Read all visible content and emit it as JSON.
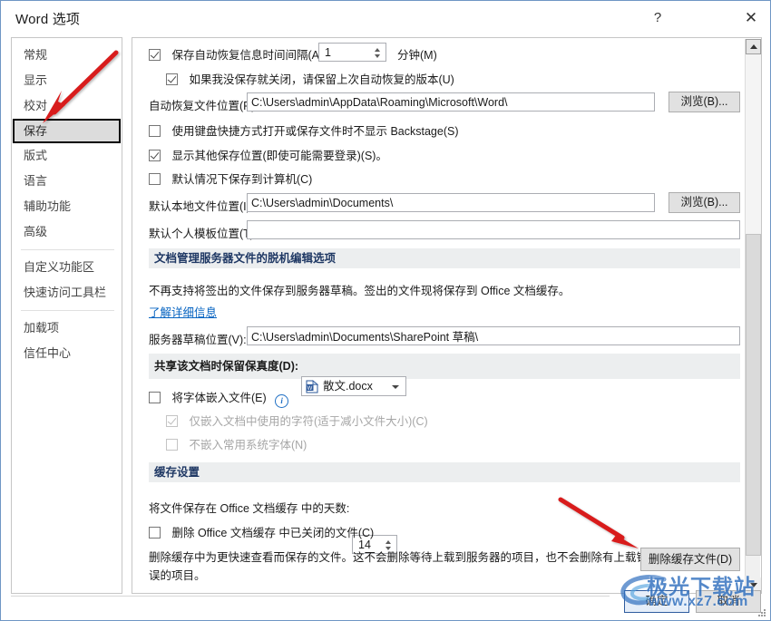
{
  "window": {
    "title": "Word 选项",
    "help_label": "?",
    "close_label": "✕"
  },
  "sidebar": {
    "items": [
      {
        "label": "常规",
        "selected": false
      },
      {
        "label": "显示",
        "selected": false
      },
      {
        "label": "校对",
        "selected": false
      },
      {
        "label": "保存",
        "selected": true
      },
      {
        "label": "版式",
        "selected": false
      },
      {
        "label": "语言",
        "selected": false
      },
      {
        "label": "辅助功能",
        "selected": false
      },
      {
        "label": "高级",
        "selected": false
      },
      {
        "label": "自定义功能区",
        "selected": false
      },
      {
        "label": "快速访问工具栏",
        "selected": false
      },
      {
        "label": "加载项",
        "selected": false
      },
      {
        "label": "信任中心",
        "selected": false
      }
    ]
  },
  "main": {
    "autorecover": {
      "interval_checkbox_label": "保存自动恢复信息时间间隔(A)",
      "interval_checked": true,
      "interval_value": "1",
      "minutes_label": "分钟(M)",
      "keep_last_checkbox_label": "如果我没保存就关闭，请保留上次自动恢复的版本(U)",
      "keep_last_checked": true,
      "location_label": "自动恢复文件位置(R):",
      "location_value": "C:\\Users\\admin\\AppData\\Roaming\\Microsoft\\Word\\",
      "browse_label": "浏览(B)..."
    },
    "backstage_checkbox_label": "使用键盘快捷方式打开或保存文件时不显示 Backstage(S)",
    "backstage_checked": false,
    "show_other_locations_label": "显示其他保存位置(即使可能需要登录)(S)。",
    "show_other_locations_checked": true,
    "save_to_computer_label": "默认情况下保存到计算机(C)",
    "save_to_computer_checked": false,
    "local_file_location_label": "默认本地文件位置(I):",
    "local_file_location_value": "C:\\Users\\admin\\Documents\\",
    "local_browse_label": "浏览(B)...",
    "personal_template_label": "默认个人模板位置(T):",
    "personal_template_value": "",
    "offline_section": {
      "header": "文档管理服务器文件的脱机编辑选项",
      "description": "不再支持将签出的文件保存到服务器草稿。签出的文件现将保存到 Office 文档缓存。",
      "link_label": "了解详细信息",
      "draft_location_label": "服务器草稿位置(V):",
      "draft_location_value": "C:\\Users\\admin\\Documents\\SharePoint 草稿\\"
    },
    "fidelity_section": {
      "header": "共享该文档时保留保真度(D):",
      "doc_name": "散文.docx",
      "doc_icon": "word-document-icon",
      "embed_fonts_label": "将字体嵌入文件(E)",
      "embed_fonts_checked": false,
      "info_icon": "info-icon",
      "embed_used_chars_label": "仅嵌入文档中使用的字符(适于减小文件大小)(C)",
      "embed_used_chars_checked": true,
      "embed_used_chars_disabled": true,
      "no_embed_system_label": "不嵌入常用系统字体(N)",
      "no_embed_system_checked": false,
      "no_embed_system_disabled": true
    },
    "cache_section": {
      "header": "缓存设置",
      "days_label": "将文件保存在 Office 文档缓存 中的天数:",
      "days_value": "14",
      "delete_closed_label": "删除 Office 文档缓存 中已关闭的文件(C)",
      "delete_closed_checked": false,
      "description_line1": "删除缓存中为更快速查看而保存的文件。这不会删除等待上载到服务器的项目，也不会删除有上载错",
      "description_line2": "误的项目。",
      "delete_cache_button_label": "删除缓存文件(D)"
    }
  },
  "footer": {
    "ok_label": "确定",
    "cancel_label": "取消"
  },
  "annotations": {
    "arrow_color": "#d81f1f",
    "arrow_1_target": "保存",
    "arrow_2_target": "删除缓存文件(D)"
  },
  "watermark": {
    "main_text": "极光下载站",
    "sub_text": "www.xz7.com",
    "color": "#2f6fbe"
  }
}
